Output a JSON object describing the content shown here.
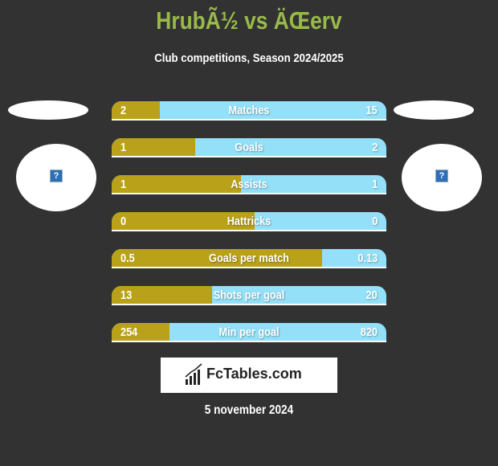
{
  "header": {
    "title": "HrubÃ½ vs ÄŒerv",
    "subtitle": "Club competitions, Season 2024/2025"
  },
  "teams": {
    "left": {
      "logo_icon": "broken-image-icon"
    },
    "right": {
      "logo_icon": "broken-image-icon"
    }
  },
  "colors": {
    "left_bar": "#b9a21a",
    "right_bar": "#93e0f8",
    "title": "#99b94a",
    "background": "#323232"
  },
  "chart_data": {
    "type": "bar",
    "title": "HrubÃ½ vs ÄŒerv",
    "subtitle": "Club competitions, Season 2024/2025",
    "categories": [
      "Matches",
      "Goals",
      "Assists",
      "Hattricks",
      "Goals per match",
      "Shots per goal",
      "Min per goal"
    ],
    "series": [
      {
        "name": "HrubÃ½",
        "values": [
          2,
          1,
          1,
          0,
          0.5,
          13,
          254
        ],
        "labels": [
          "2",
          "1",
          "1",
          "0",
          "0.5",
          "13",
          "254"
        ]
      },
      {
        "name": "ÄŒerv",
        "values": [
          15,
          2,
          1,
          0,
          0.13,
          20,
          820
        ],
        "labels": [
          "15",
          "2",
          "1",
          "0",
          "0.13",
          "20",
          "820"
        ]
      }
    ],
    "left_share": [
      0.175,
      0.305,
      0.47,
      0.52,
      0.765,
      0.365,
      0.21
    ]
  },
  "brand": {
    "name": "FcTables.com",
    "icon": "bar-chart-icon"
  },
  "footer": {
    "date": "5 november 2024"
  }
}
